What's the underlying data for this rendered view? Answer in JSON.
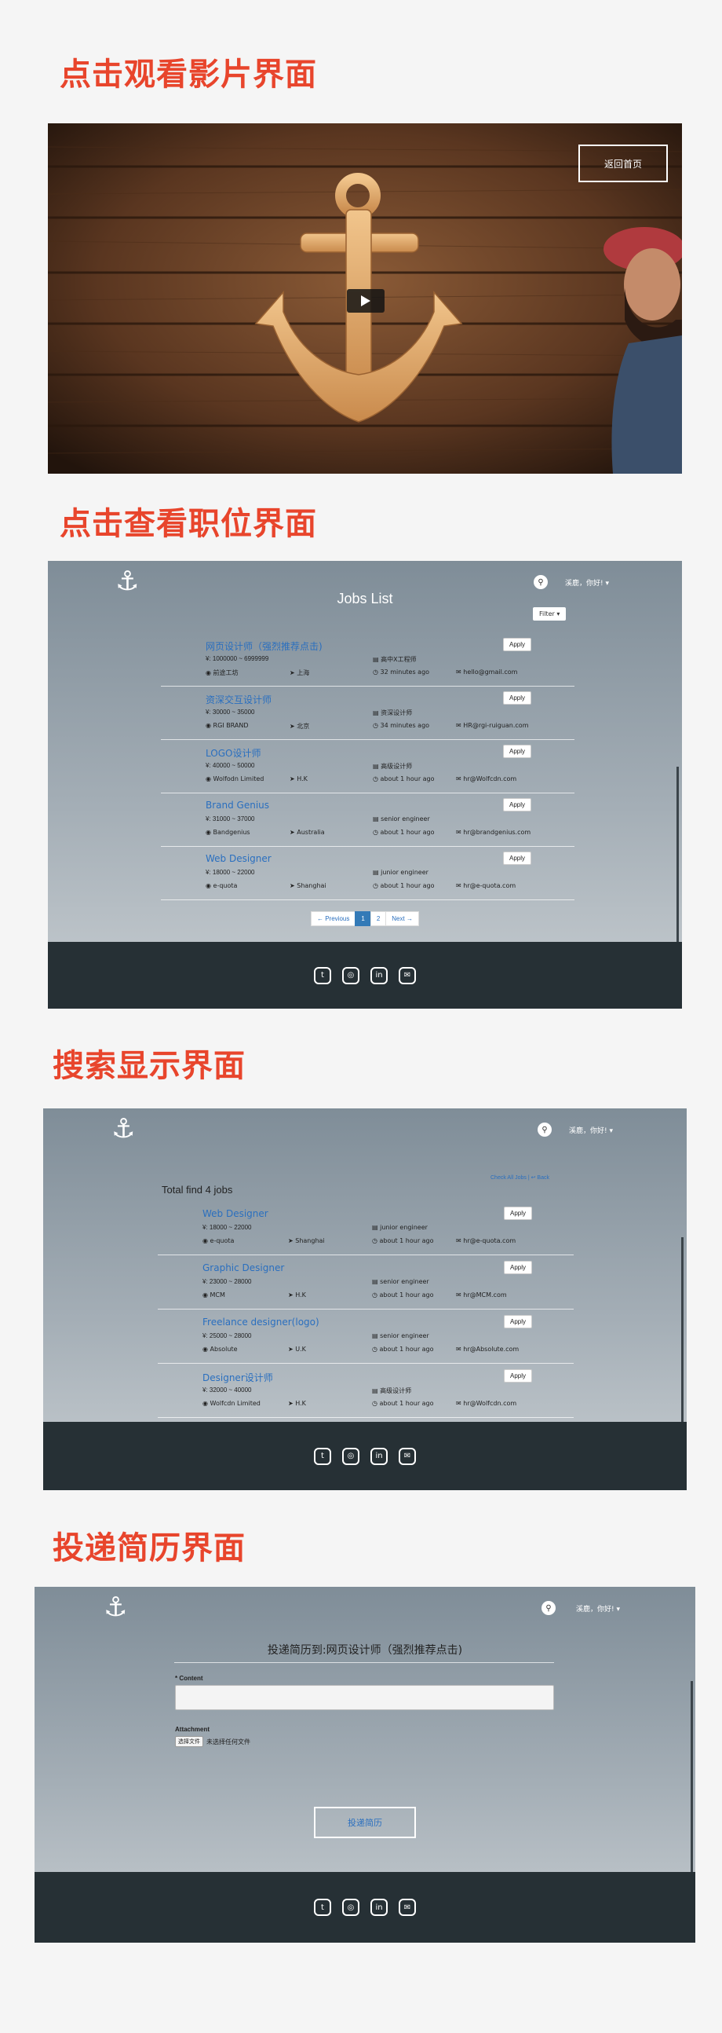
{
  "sections": {
    "video": {
      "heading": "点击观看影片界面",
      "back_button": "返回首页",
      "play_icon": "play-icon"
    },
    "jobs": {
      "heading": "点击查看职位界面"
    },
    "search": {
      "heading": "搜索显示界面"
    },
    "apply": {
      "heading": "投递简历界面"
    }
  },
  "nav": {
    "user_greeting": "溪鹿，你好!",
    "dropdown": "▾"
  },
  "jobs_page": {
    "title": "Jobs List",
    "filter": "Filter ▾",
    "items": [
      {
        "title": "网页设计师（强烈推荐点击)",
        "salary": "¥: 1000000 ~ 6999999",
        "company": "前途工坊",
        "location": "上海",
        "level": "高中X工程师",
        "time": "32 minutes ago",
        "email": "hello@gmail.com",
        "apply": "Apply"
      },
      {
        "title": "资深交互设计师",
        "salary": "¥: 30000 ~ 35000",
        "company": "RGI BRAND",
        "location": "北京",
        "level": "资深设计师",
        "time": "34 minutes ago",
        "email": "HR@rgi-ruiguan.com",
        "apply": "Apply"
      },
      {
        "title": "LOGO设计师",
        "salary": "¥: 40000 ~ 50000",
        "company": "Wolfodn Limited",
        "location": "H.K",
        "level": "高级设计师",
        "time": "about 1 hour ago",
        "email": "hr@Wolfcdn.com",
        "apply": "Apply"
      },
      {
        "title": "Brand Genius",
        "salary": "¥: 31000 ~ 37000",
        "company": "Bandgenius",
        "location": "Australia",
        "level": "senior engineer",
        "time": "about 1 hour ago",
        "email": "hr@brandgenius.com",
        "apply": "Apply"
      },
      {
        "title": "Web Designer",
        "salary": "¥: 18000 ~ 22000",
        "company": "e-quota",
        "location": "Shanghai",
        "level": "junior engineer",
        "time": "about 1 hour ago",
        "email": "hr@e-quota.com",
        "apply": "Apply"
      }
    ],
    "pager": {
      "prev": "← Previous",
      "pages": [
        "1",
        "2"
      ],
      "next": "Next →"
    }
  },
  "search_page": {
    "result_title": "Total find 4 jobs",
    "check_all": "Check All Jobs | ↩ Back",
    "items": [
      {
        "title": "Web Designer",
        "salary": "¥: 18000 ~ 22000",
        "company": "e-quota",
        "location": "Shanghai",
        "level": "junior engineer",
        "time": "about 1 hour ago",
        "email": "hr@e-quota.com",
        "apply": "Apply"
      },
      {
        "title": "Graphic Designer",
        "salary": "¥: 23000 ~ 28000",
        "company": "MCM",
        "location": "H.K",
        "level": "senior engineer",
        "time": "about 1 hour ago",
        "email": "hr@MCM.com",
        "apply": "Apply"
      },
      {
        "title": "Freelance designer(logo)",
        "salary": "¥: 25000 ~ 28000",
        "company": "Absolute",
        "location": "U.K",
        "level": "senior engineer",
        "time": "about 1 hour ago",
        "email": "hr@Absolute.com",
        "apply": "Apply"
      },
      {
        "title": "Designer设计师",
        "salary": "¥: 32000 ~ 40000",
        "company": "Wolfcdn Limited",
        "location": "H.K",
        "level": "高级设计师",
        "time": "about 1 hour ago",
        "email": "hr@Wolfcdn.com",
        "apply": "Apply"
      }
    ]
  },
  "apply_page": {
    "title": "投递简历到:网页设计师（强烈推荐点击)",
    "content_label": "* Content",
    "attachment_label": "Attachment",
    "file_button": "选择文件",
    "file_status": "未选择任何文件",
    "submit": "投递简历"
  },
  "footer": {
    "icons": [
      "twitter-icon",
      "github-icon",
      "linkedin-icon",
      "envelope-icon"
    ],
    "glyphs": [
      "t",
      "◎",
      "in",
      "✉"
    ]
  },
  "colors": {
    "accent_heading": "#e8452c",
    "link": "#2a6fbf",
    "footer_bg": "#263035"
  }
}
